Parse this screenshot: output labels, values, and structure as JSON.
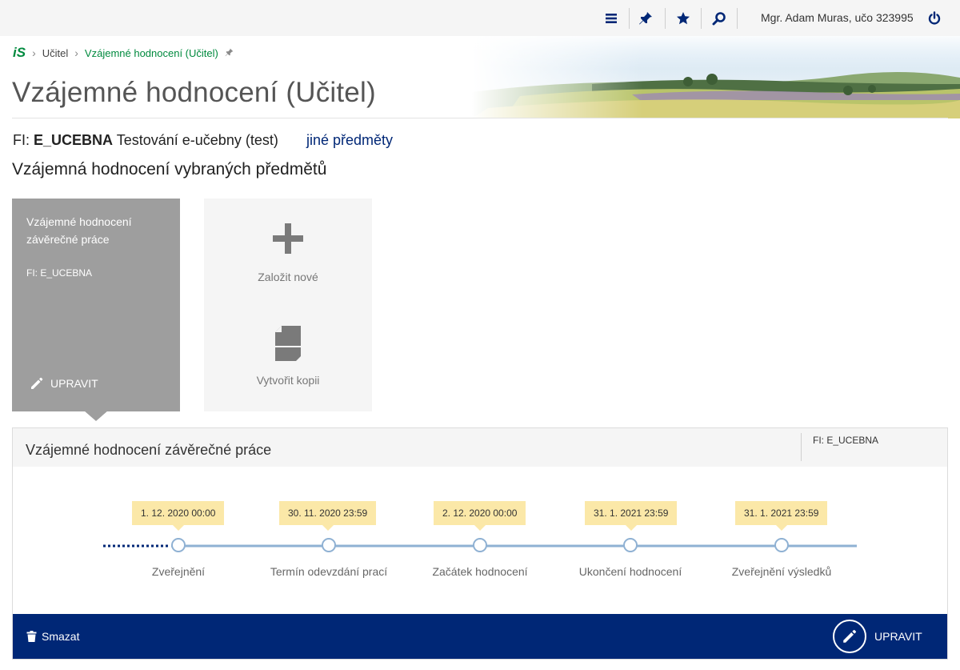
{
  "topbar": {
    "icons": [
      "menu-icon",
      "pin-icon",
      "star-icon",
      "search-icon",
      "power-icon"
    ],
    "user": "Mgr. Adam Muras, učo 323995"
  },
  "breadcrumb": {
    "logo": "iS",
    "items": [
      "Učitel",
      "Vzájemné hodnocení (Učitel)"
    ]
  },
  "page": {
    "title": "Vzájemné hodnocení (Učitel)",
    "course_prefix": "FI:",
    "course_code": "E_UCEBNA",
    "course_name": "Testování e-učebny (test)",
    "other_courses": "jiné předměty",
    "subtitle": "Vzájemná hodnocení vybraných předmětů"
  },
  "tiles": {
    "active": {
      "title": "Vzájemné hodnocení závěrečné práce",
      "code": "FI: E_UCEBNA",
      "edit_label": "UPRAVIT"
    },
    "new": {
      "create_label": "Založit nové",
      "copy_label": "Vytvořit kopii"
    }
  },
  "detail": {
    "title": "Vzájemné hodnocení závěrečné práce",
    "code": "FI: E_UCEBNA",
    "timeline": [
      {
        "date": "1. 12. 2020 00:00",
        "label": "Zveřejnění"
      },
      {
        "date": "30. 11. 2020 23:59",
        "label": "Termín odevzdání prací"
      },
      {
        "date": "2. 12. 2020 00:00",
        "label": "Začátek hodnocení"
      },
      {
        "date": "31. 1. 2021 23:59",
        "label": "Ukončení hodnocení"
      },
      {
        "date": "31. 1. 2021 23:59",
        "label": "Zveřejnění výsledků"
      }
    ],
    "delete_label": "Smazat",
    "edit_label": "UPRAVIT"
  },
  "colors": {
    "accent": "#002776",
    "breadcrumb_current": "#008a3e",
    "tile_active": "#9e9e9e",
    "date_badge": "#fbe8a8",
    "timeline": "#8fb1d3"
  }
}
